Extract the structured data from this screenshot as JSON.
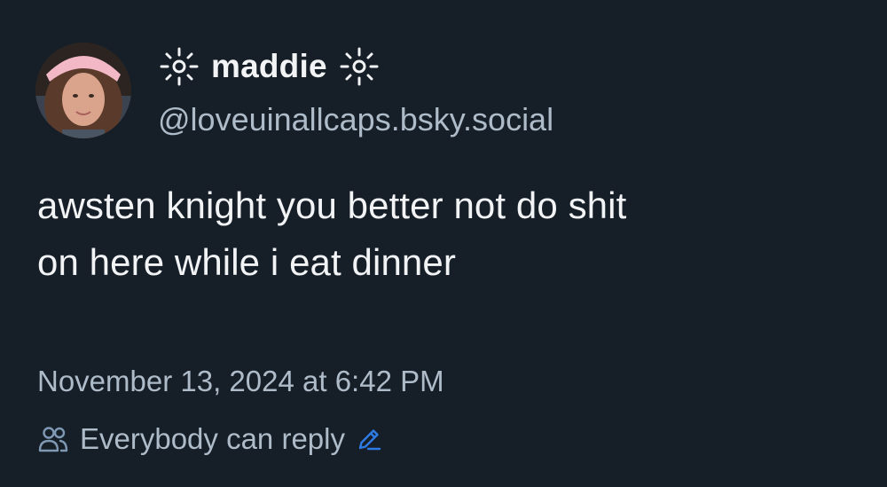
{
  "post": {
    "author": {
      "display_name": "maddie",
      "name_decoration_icon": "sparkle-icon",
      "handle": "@loveuinallcaps.bsky.social",
      "avatar_icon": "avatar"
    },
    "text_lines": [
      "awsten knight you better not do shit",
      "on here while i eat dinner"
    ],
    "timestamp": "November 13, 2024 at 6:42 PM",
    "reply_setting": {
      "icon": "people-icon",
      "label": "Everybody can reply",
      "edit_icon": "pencil-icon"
    }
  },
  "colors": {
    "background": "#161e27",
    "primary_text": "#f1f3f5",
    "secondary_text": "#aebbc9",
    "accent": "#2f7be6"
  }
}
